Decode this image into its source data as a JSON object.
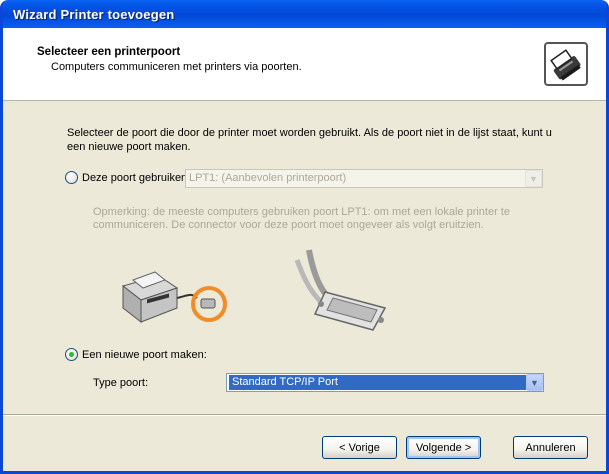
{
  "window": {
    "title": "Wizard Printer toevoegen"
  },
  "header": {
    "title": "Selecteer een printerpoort",
    "subtitle": "Computers communiceren met printers via poorten.",
    "icon": "printer-port-icon"
  },
  "content": {
    "description": "Selecteer de poort die door de printer moet worden gebruikt. Als de poort niet in de lijst staat, kunt u een nieuwe poort maken.",
    "existing_port": {
      "label": "Deze poort gebruiken:",
      "selected": false,
      "enabled": false,
      "dropdown_value": "LPT1: (Aanbevolen printerpoort)"
    },
    "note": "Opmerking: de meeste computers gebruiken poort LPT1: om met een lokale printer te communiceren. De connector voor deze poort moet ongeveer als volgt eruitzien.",
    "new_port": {
      "label": "Een nieuwe poort maken:",
      "selected": true,
      "type_label": "Type poort:",
      "type_value": "Standard TCP/IP Port"
    }
  },
  "buttons": {
    "back": "< Vorige",
    "next": "Volgende >",
    "cancel": "Annuleren"
  },
  "colors": {
    "titlebar": "#0348d7",
    "dialog_background": "#ece9d8",
    "selection": "#316ac5",
    "radio_checked": "#2bbd2b",
    "highlight_circle": "#f28c28"
  }
}
